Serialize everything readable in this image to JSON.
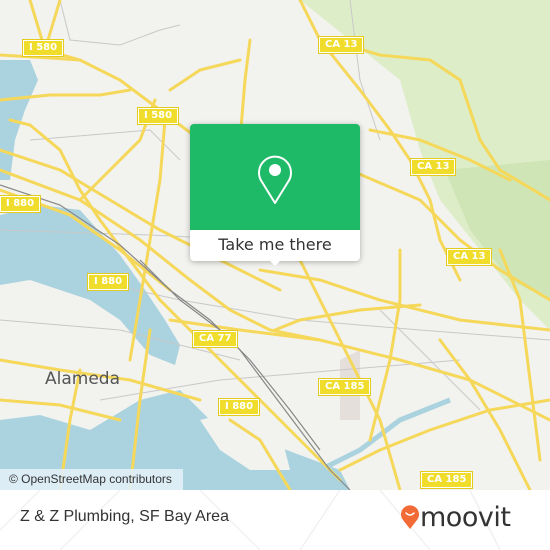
{
  "map": {
    "attribution": "© OpenStreetMap contributors",
    "city_label": "Alameda",
    "road_shields": [
      {
        "id": "i580-a",
        "text": "I 580"
      },
      {
        "id": "i580-b",
        "text": "I 580"
      },
      {
        "id": "i880-a",
        "text": "I 880"
      },
      {
        "id": "i880-b",
        "text": "I 880"
      },
      {
        "id": "i880-c",
        "text": "I 880"
      },
      {
        "id": "ca13-a",
        "text": "CA 13"
      },
      {
        "id": "ca13-b",
        "text": "CA 13"
      },
      {
        "id": "ca13-c",
        "text": "CA 13"
      },
      {
        "id": "ca77",
        "text": "CA 77"
      },
      {
        "id": "ca185-a",
        "text": "CA 185"
      },
      {
        "id": "ca185-b",
        "text": "CA 185"
      }
    ],
    "colors": {
      "land": "#f2f2ef",
      "water": "#aad3df",
      "park": "#d8ebc4",
      "road": "#f7e06b",
      "shield": "#f0dc2a"
    }
  },
  "popup": {
    "icon": "location-pin-icon",
    "button_label": "Take me there",
    "color": "#1fba67"
  },
  "footer": {
    "place_title": "Z & Z Plumbing, SF Bay Area",
    "brand_name": "moovit",
    "brand_icon": "moovit-pin-smile-icon",
    "brand_color": "#f26a36"
  }
}
